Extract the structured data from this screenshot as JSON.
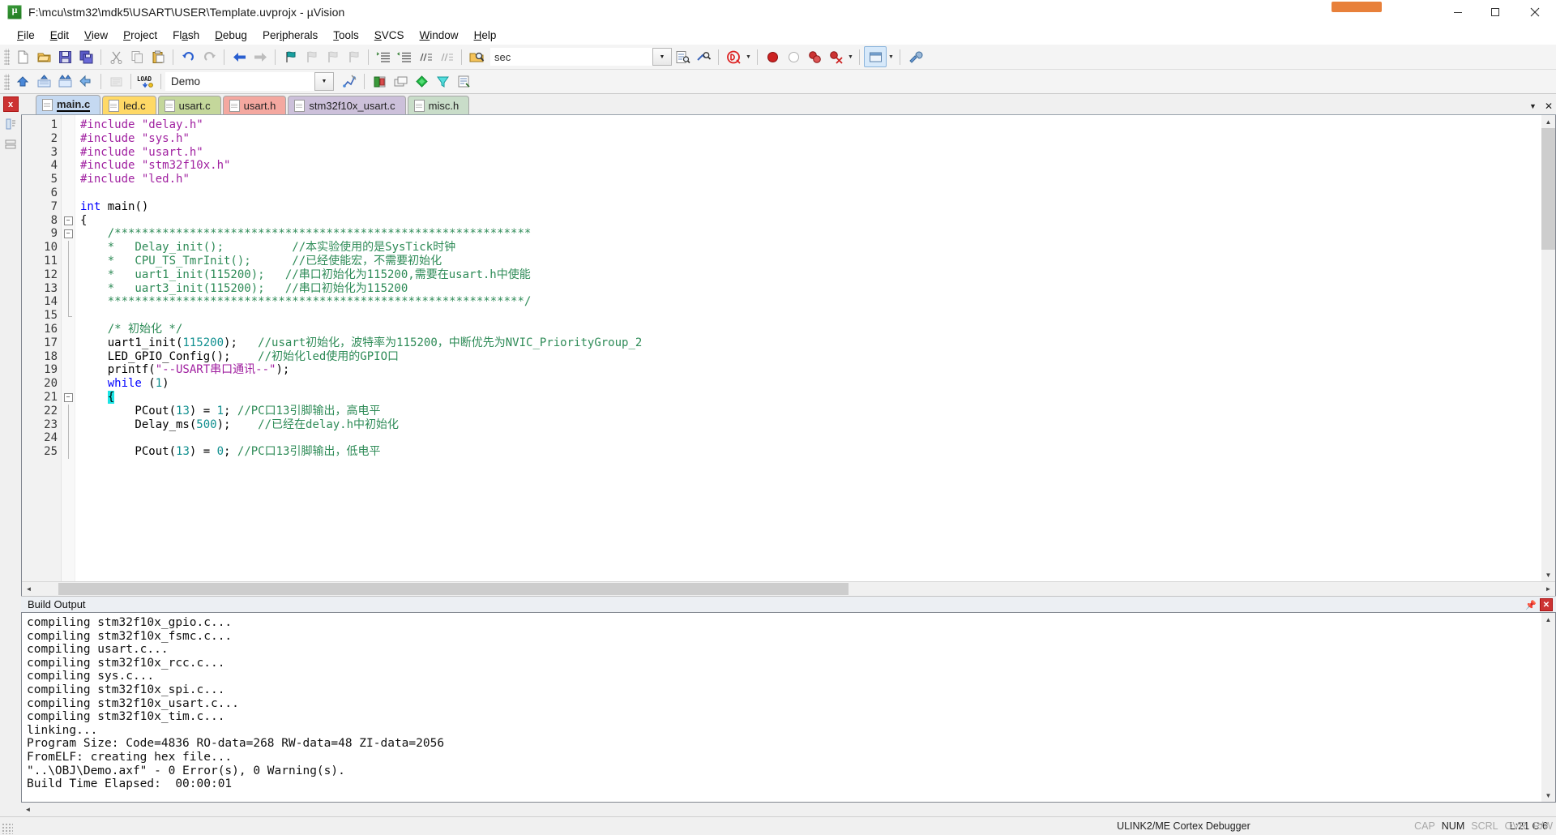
{
  "window": {
    "title": "F:\\mcu\\stm32\\mdk5\\USART\\USER\\Template.uvprojx - µVision",
    "app_icon": "uvision-logo-icon",
    "minimize": "minimize-icon",
    "maximize": "maximize-icon",
    "close": "close-icon"
  },
  "menu": [
    {
      "label": "File",
      "accel": "F"
    },
    {
      "label": "Edit",
      "accel": "E"
    },
    {
      "label": "View",
      "accel": "V"
    },
    {
      "label": "Project",
      "accel": "P"
    },
    {
      "label": "Flash",
      "accel": "a"
    },
    {
      "label": "Debug",
      "accel": "D"
    },
    {
      "label": "Peripherals",
      "accel": "i"
    },
    {
      "label": "Tools",
      "accel": "T"
    },
    {
      "label": "SVCS",
      "accel": "S"
    },
    {
      "label": "Window",
      "accel": "W"
    },
    {
      "label": "Help",
      "accel": "H"
    }
  ],
  "toolbar1": {
    "search_value": "sec",
    "search_placeholder": "",
    "icons": [
      "new-file-icon",
      "open-file-icon",
      "save-icon",
      "save-all-icon",
      "cut-icon",
      "copy-icon",
      "paste-icon",
      "undo-icon",
      "redo-icon",
      "navigate-back-icon",
      "navigate-forward-icon",
      "bookmark-toggle-icon",
      "bookmark-prev-icon",
      "bookmark-next-icon",
      "bookmark-clear-icon",
      "indent-right-icon",
      "indent-left-icon",
      "comment-icon",
      "uncomment-icon",
      "find-in-files-icon",
      "incremental-find-icon",
      "browse-symbol-icon",
      "debug-session-icon",
      "start-stop-debug-icon",
      "insert-breakpoint-icon",
      "configure-target-icon",
      "settings-icon"
    ]
  },
  "toolbar2": {
    "project_target": "Demo",
    "icons": [
      "build-icon",
      "rebuild-icon",
      "batch-build-icon",
      "translate-icon",
      "stop-build-icon",
      "load-icon",
      "target-options-icon",
      "manage-runtime-icon",
      "project-window-icon",
      "books-window-icon",
      "functions-window-icon",
      "templates-window-icon",
      "source-browser-icon"
    ]
  },
  "left_rail": {
    "close_label": "x",
    "icons": [
      "project-pane-icon",
      "registers-pane-icon"
    ]
  },
  "tabs": [
    {
      "label": "main.c",
      "color": "#c5d9f1",
      "active": true
    },
    {
      "label": "led.c",
      "color": "#ffd966",
      "active": false
    },
    {
      "label": "usart.c",
      "color": "#c4d79b",
      "active": false
    },
    {
      "label": "usart.h",
      "color": "#f4a8a0",
      "active": false
    },
    {
      "label": "stm32f10x_usart.c",
      "color": "#ccc0da",
      "active": false
    },
    {
      "label": "misc.h",
      "color": "#c9ddc9",
      "active": false
    }
  ],
  "tabstrip_buttons": [
    "tab-list-icon",
    "tab-close-icon"
  ],
  "editor": {
    "first_line": 1,
    "lines": [
      {
        "n": 1,
        "fold": "",
        "html": "<span class='pp'>#include</span> <span class='str'>\"delay.h\"</span>"
      },
      {
        "n": 2,
        "fold": "",
        "html": "<span class='pp'>#include</span> <span class='str'>\"sys.h\"</span>"
      },
      {
        "n": 3,
        "fold": "",
        "html": "<span class='pp'>#include</span> <span class='str'>\"usart.h\"</span>"
      },
      {
        "n": 4,
        "fold": "",
        "html": "<span class='pp'>#include</span> <span class='str'>\"stm32f10x.h\"</span>"
      },
      {
        "n": 5,
        "fold": "",
        "html": "<span class='pp'>#include</span> <span class='str'>\"led.h\"</span>"
      },
      {
        "n": 6,
        "fold": "",
        "html": ""
      },
      {
        "n": 7,
        "fold": "",
        "html": "<span class='k'>int</span> main()"
      },
      {
        "n": 8,
        "fold": "minus",
        "html": "{"
      },
      {
        "n": 9,
        "fold": "minus",
        "html": "    <span class='cm'>/*************************************************************</span>"
      },
      {
        "n": 10,
        "fold": "line",
        "html": "    <span class='cm'>*   Delay_init();          //本实验使用的是SysTick时钟</span>"
      },
      {
        "n": 11,
        "fold": "line",
        "html": "    <span class='cm'>*   CPU_TS_TmrInit();      //已经使能宏，不需要初始化</span>"
      },
      {
        "n": 12,
        "fold": "line",
        "html": "    <span class='cm'>*   uart1_init(115200);   //串口初始化为115200,需要在usart.h中使能</span>"
      },
      {
        "n": 13,
        "fold": "line",
        "html": "    <span class='cm'>*   uart3_init(115200);   //串口初始化为115200</span>"
      },
      {
        "n": 14,
        "fold": "line",
        "html": "    <span class='cm'>*************************************************************/</span>"
      },
      {
        "n": 15,
        "fold": "end",
        "html": ""
      },
      {
        "n": 16,
        "fold": "",
        "html": "    <span class='cm'>/* 初始化 */</span>"
      },
      {
        "n": 17,
        "fold": "",
        "html": "    uart1_init(<span class='num'>115200</span>);   <span class='cm'>//usart初始化，波特率为115200，中断优先为NVIC_PriorityGroup_2</span>"
      },
      {
        "n": 18,
        "fold": "",
        "html": "    LED_GPIO_Config();    <span class='cm'>//初始化led使用的GPIO口</span>"
      },
      {
        "n": 19,
        "fold": "",
        "html": "    printf(<span class='str'>\"--USART串口通讯--\"</span>);"
      },
      {
        "n": 20,
        "fold": "",
        "html": "    <span class='k'>while</span> (<span class='num'>1</span>)"
      },
      {
        "n": 21,
        "fold": "minus",
        "html": "    <span class='sel'>{</span>"
      },
      {
        "n": 22,
        "fold": "line",
        "html": "        PCout(<span class='num'>13</span>) = <span class='num'>1</span>; <span class='cm'>//PC口13引脚输出，高电平</span>"
      },
      {
        "n": 23,
        "fold": "line",
        "html": "        Delay_ms(<span class='num'>500</span>);    <span class='cm'>//已经在delay.h中初始化</span>"
      },
      {
        "n": 24,
        "fold": "line",
        "html": ""
      },
      {
        "n": 25,
        "fold": "line",
        "html": "        PCout(<span class='num'>13</span>) = <span class='num'>0</span>; <span class='cm'>//PC口13引脚输出，低电平</span>"
      }
    ]
  },
  "build_panel": {
    "title": "Build Output",
    "pin_icon": "pin-icon",
    "close_icon": "close-icon",
    "lines": [
      "compiling stm32f10x_gpio.c...",
      "compiling stm32f10x_fsmc.c...",
      "compiling usart.c...",
      "compiling stm32f10x_rcc.c...",
      "compiling sys.c...",
      "compiling stm32f10x_spi.c...",
      "compiling stm32f10x_usart.c...",
      "compiling stm32f10x_tim.c...",
      "linking...",
      "Program Size: Code=4836 RO-data=268 RW-data=48 ZI-data=2056",
      "FromELF: creating hex file...",
      "\"..\\OBJ\\Demo.axf\" - 0 Error(s), 0 Warning(s).",
      "Build Time Elapsed:  00:00:01"
    ]
  },
  "statusbar": {
    "debugger": "ULINK2/ME Cortex Debugger",
    "cursor": "L:21 C:6",
    "cap": "CAP",
    "num": "NUM",
    "scrl": "SCRL",
    "ovr": "OVR",
    "rw": "R/W"
  },
  "colors": {
    "tab_active": "#c5d9f1",
    "comment_green": "#2e8b57",
    "keyword_blue": "#0000ff",
    "string_purple": "#a020a0",
    "number_teal": "#0f8f8f",
    "selection_cyan": "#1ae5e5",
    "accent_orange": "#e8803a",
    "close_red": "#cc3333"
  }
}
